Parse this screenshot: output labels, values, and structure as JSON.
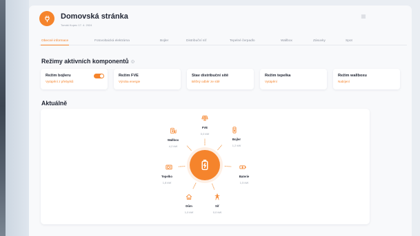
{
  "page": {
    "title": "Domovská stránka",
    "subtitle": "Tomáš Kupec 17. 4. 2024",
    "logo_icon": "plug-icon",
    "menu_icon": "menu-icon"
  },
  "tabs": [
    {
      "label": "Obecné informace",
      "active": true
    },
    {
      "label": "Fotovoltaická elektrárna",
      "active": false
    },
    {
      "label": "Bojler",
      "active": false
    },
    {
      "label": "Distribuční síť",
      "active": false
    },
    {
      "label": "Tepelné čerpadlo",
      "active": false
    },
    {
      "label": "Wallbox",
      "active": false
    },
    {
      "label": "Zásuvky",
      "active": false
    },
    {
      "label": "Spot",
      "active": false
    }
  ],
  "modes": {
    "title": "Režimy aktivních komponentů",
    "info_icon": "info-icon",
    "cards": [
      {
        "title": "Režim bojleru",
        "status": "Vytápění z přebytků",
        "toggle_on": true
      },
      {
        "title": "Režim FVE",
        "status": "Výroba energie"
      },
      {
        "title": "Stav distribuční sítě",
        "status": "Běžný odběr ze sítě"
      },
      {
        "title": "Režim tepelka",
        "status": "Vytápění"
      },
      {
        "title": "Režim wallboxu",
        "status": "Nabíjení"
      }
    ]
  },
  "current": {
    "title": "Aktuálně",
    "center_icon": "home-battery-icon",
    "nodes": [
      {
        "label": "FVE",
        "value": "0,0 kW",
        "icon": "solar-panel-icon"
      },
      {
        "label": "Bojler",
        "value": "1,2 kW",
        "icon": "water-heater-icon"
      },
      {
        "label": "Baterie",
        "value": "1,5 kW",
        "icon": "battery-icon"
      },
      {
        "label": "Síť",
        "value": "0,0 kW",
        "icon": "power-pylon-icon"
      },
      {
        "label": "Dům",
        "value": "1,0 kW",
        "icon": "house-icon"
      },
      {
        "label": "Tepelko",
        "value": "1,8 kW",
        "icon": "heat-pump-icon"
      },
      {
        "label": "Wallbox",
        "value": "4,2 kW",
        "icon": "ev-charger-icon"
      }
    ]
  },
  "colors": {
    "accent": "#f5842c",
    "text": "#1f2432",
    "muted": "#9aa1ad"
  }
}
